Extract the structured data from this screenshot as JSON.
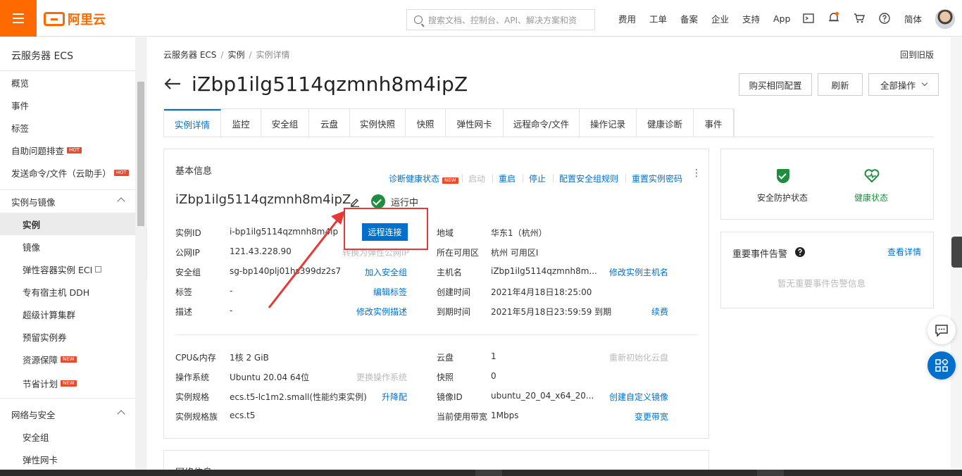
{
  "topbar": {
    "logo_text": "阿里云",
    "search_placeholder": "搜索文档、控制台、API、解决方案和资",
    "nav": [
      "费用",
      "工单",
      "备案",
      "企业",
      "支持",
      "App"
    ],
    "lang": "简体",
    "icons": [
      "terminal-icon",
      "bell-icon",
      "cart-icon",
      "help-icon"
    ]
  },
  "sidebar": {
    "title": "云服务器 ECS",
    "items_top": [
      {
        "label": "概览"
      },
      {
        "label": "事件"
      },
      {
        "label": "标签"
      },
      {
        "label": "自助问题排查",
        "badge": "HOT"
      },
      {
        "label": "发送命令/文件（云助手）",
        "badge": "HOT"
      }
    ],
    "group1": {
      "label": "实例与镜像",
      "items": [
        {
          "label": "实例",
          "active": true
        },
        {
          "label": "镜像"
        },
        {
          "label": "弹性容器实例 ECI"
        },
        {
          "label": "专有宿主机 DDH"
        },
        {
          "label": "超级计算集群"
        },
        {
          "label": "预留实例券"
        },
        {
          "label": "资源保障",
          "badge": "NEW"
        },
        {
          "label": "节省计划",
          "badge": "NEW"
        }
      ]
    },
    "group2": {
      "label": "网络与安全",
      "items": [
        {
          "label": "安全组"
        },
        {
          "label": "弹性网卡"
        }
      ]
    }
  },
  "breadcrumb": [
    "云服务器 ECS",
    "实例",
    "实例详情"
  ],
  "old_version": "回到旧版",
  "page_title": "iZbp1ilg5114qzmnh8m4ipZ",
  "header_buttons": {
    "buy_same": "购买相同配置",
    "refresh": "刷新",
    "all_ops": "全部操作"
  },
  "tabs": [
    "实例详情",
    "监控",
    "安全组",
    "云盘",
    "实例快照",
    "快照",
    "弹性网卡",
    "远程命令/文件",
    "操作记录",
    "健康诊断",
    "事件"
  ],
  "basic": {
    "title": "基本信息",
    "actions": {
      "diagnose": "诊断健康状态",
      "diagnose_badge": "NEW",
      "start": "启动",
      "restart": "重启",
      "stop": "停止",
      "sg_rules": "配置安全组规则",
      "reset_pwd": "重置实例密码"
    },
    "instance_name": "iZbp1ilg5114qzmnh8m4ipZ",
    "status": "运行中",
    "remote_connect": "远程连接",
    "left_rows": [
      {
        "label": "实例ID",
        "value": "i-bp1ilg5114qzmnh8m4ip",
        "action": ""
      },
      {
        "label": "公网IP",
        "value": "121.43.228.90",
        "action": "转换为弹性公网IP"
      },
      {
        "label": "安全组",
        "value": "sg-bp140plj01hs399dz2s7",
        "action": "加入安全组"
      },
      {
        "label": "标签",
        "value": "-",
        "action": "编辑标签"
      },
      {
        "label": "描述",
        "value": "-",
        "action": "修改实例描述"
      }
    ],
    "right_rows": [
      {
        "label": "地域",
        "value": "华东1（杭州）",
        "action": ""
      },
      {
        "label": "所在可用区",
        "value": "杭州 可用区I",
        "action": ""
      },
      {
        "label": "主机名",
        "value": "iZbp1ilg5114qzmnh8m...",
        "action": "修改实例主机名"
      },
      {
        "label": "创建时间",
        "value": "2021年4月18日18:25:00",
        "action": ""
      },
      {
        "label": "到期时间",
        "value": "2021年5月18日23:59:59 到期",
        "action": "续费"
      }
    ],
    "left_rows2": [
      {
        "label": "CPU&内存",
        "value": "1核 2 GiB",
        "action": ""
      },
      {
        "label": "操作系统",
        "value": "Ubuntu 20.04 64位",
        "action": "更换操作系统"
      },
      {
        "label": "实例规格",
        "value": "ecs.t5-lc1m2.small(性能约束实例)",
        "action": "升降配"
      },
      {
        "label": "实例规格族",
        "value": "ecs.t5",
        "action": ""
      }
    ],
    "right_rows2": [
      {
        "label": "云盘",
        "value": "1",
        "action": "重新初始化云盘"
      },
      {
        "label": "快照",
        "value": "0",
        "action": ""
      },
      {
        "label": "镜像ID",
        "value": "ubuntu_20_04_x64_20...",
        "action": "创建自定义镜像"
      },
      {
        "label": "当前使用带宽",
        "value": "1Mbps",
        "action": "变更带宽"
      }
    ]
  },
  "network_title": "网络信息",
  "security_card": {
    "security_label": "安全防护状态",
    "health_label": "健康状态"
  },
  "events_card": {
    "title": "重要事件告警",
    "link": "查看详情",
    "empty": "暂无重要事件告警信息"
  },
  "colors": {
    "brand": "#ff6a00",
    "link": "#0070cc",
    "ok": "#1e8e3e",
    "annotation": "#e53935"
  }
}
